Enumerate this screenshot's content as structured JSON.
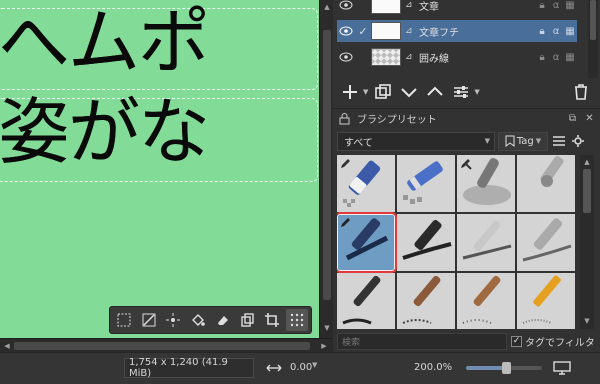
{
  "canvas": {
    "line1": "へムポ",
    "line2": "姿がな",
    "background_color": "#82dc98"
  },
  "canvas_toolbar": {
    "icons": [
      "select-all-icon",
      "deselect-icon",
      "magic-select-icon",
      "fill-icon",
      "erase-icon",
      "copy-icon",
      "crop-icon",
      "grid-icon"
    ]
  },
  "layers": {
    "rows": [
      {
        "name": "文章",
        "checked": false,
        "active": false
      },
      {
        "name": "文章フチ",
        "checked": true,
        "active": true
      },
      {
        "name": "囲み線",
        "checked": false,
        "active": false
      }
    ]
  },
  "preset_docker": {
    "title": "ブラシプリセット",
    "tag_select": "すべて",
    "tag_button": "Tag",
    "search_placeholder": "検索",
    "filter_label": "タグでフィルタ",
    "filter_checked": true,
    "selected_index": 4
  },
  "statusbar": {
    "size": "1,754 x 1,240 (41.9 MiB)",
    "rotation": "0.00°",
    "zoom": "200.0%",
    "zoom_level_fraction": 0.5
  },
  "colors": {
    "accent": "#4a6e9a",
    "selected_outline": "#e23a3a"
  }
}
